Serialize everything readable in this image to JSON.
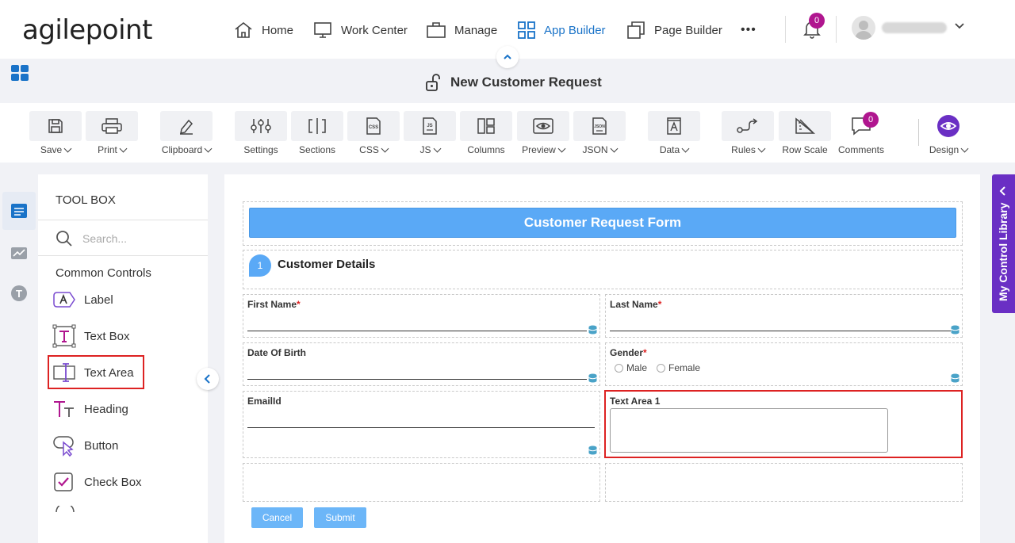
{
  "brand": {
    "logo_text": "agilepoint"
  },
  "nav": {
    "items": [
      {
        "label": "Home",
        "icon": "home-icon"
      },
      {
        "label": "Work Center",
        "icon": "monitor-icon"
      },
      {
        "label": "Manage",
        "icon": "briefcase-icon"
      },
      {
        "label": "App Builder",
        "icon": "grid-icon",
        "active": true
      },
      {
        "label": "Page Builder",
        "icon": "pages-icon"
      }
    ],
    "more_label": "•••",
    "notification_count": "0"
  },
  "header": {
    "title": "New Customer Request"
  },
  "toolbar": {
    "items": [
      {
        "label": "Save",
        "dropdown": true
      },
      {
        "label": "Print",
        "dropdown": true
      },
      {
        "label": "Clipboard",
        "dropdown": true
      },
      {
        "label": "Settings",
        "dropdown": false
      },
      {
        "label": "Sections",
        "dropdown": false
      },
      {
        "label": "CSS",
        "dropdown": true
      },
      {
        "label": "JS",
        "dropdown": true
      },
      {
        "label": "Columns",
        "dropdown": false
      },
      {
        "label": "Preview",
        "dropdown": true
      },
      {
        "label": "JSON",
        "dropdown": true
      },
      {
        "label": "Data",
        "dropdown": true
      },
      {
        "label": "Rules",
        "dropdown": true
      },
      {
        "label": "Row Scale",
        "dropdown": false
      },
      {
        "label": "Comments",
        "dropdown": false
      },
      {
        "label": "Design",
        "dropdown": true
      }
    ],
    "comments_count": "0",
    "icon_text": {
      "css": "CSS",
      "js": "JS",
      "json": "JSON"
    }
  },
  "rail": {
    "text_icon_letter": "T"
  },
  "toolbox": {
    "title": "TOOL BOX",
    "search_placeholder": "Search...",
    "section_title": "Common Controls",
    "controls": [
      {
        "label": "Label",
        "icon": "label-icon"
      },
      {
        "label": "Text Box",
        "icon": "text-box-icon"
      },
      {
        "label": "Text Area",
        "icon": "text-area-icon"
      },
      {
        "label": "Heading",
        "icon": "heading-icon"
      },
      {
        "label": "Button",
        "icon": "button-icon"
      },
      {
        "label": "Check Box",
        "icon": "check-box-icon"
      }
    ]
  },
  "form": {
    "header": "Customer Request Form",
    "section_number": "1",
    "section_title": "Customer Details",
    "fields": {
      "first_name": "First Name",
      "last_name": "Last Name",
      "dob": "Date Of Birth",
      "gender": "Gender",
      "email": "EmailId",
      "text_area": "Text Area 1"
    },
    "required_mark": "*",
    "gender_options": [
      "Male",
      "Female"
    ],
    "buttons": {
      "cancel": "Cancel",
      "submit": "Submit"
    }
  },
  "right_panel": {
    "label": "My Control Library"
  },
  "colors": {
    "accent": "#1a73c8",
    "header_bar": "#5aa9f6",
    "badge": "#b0168f",
    "library_tab": "#6a2fc4",
    "highlight": "#dd2222"
  }
}
